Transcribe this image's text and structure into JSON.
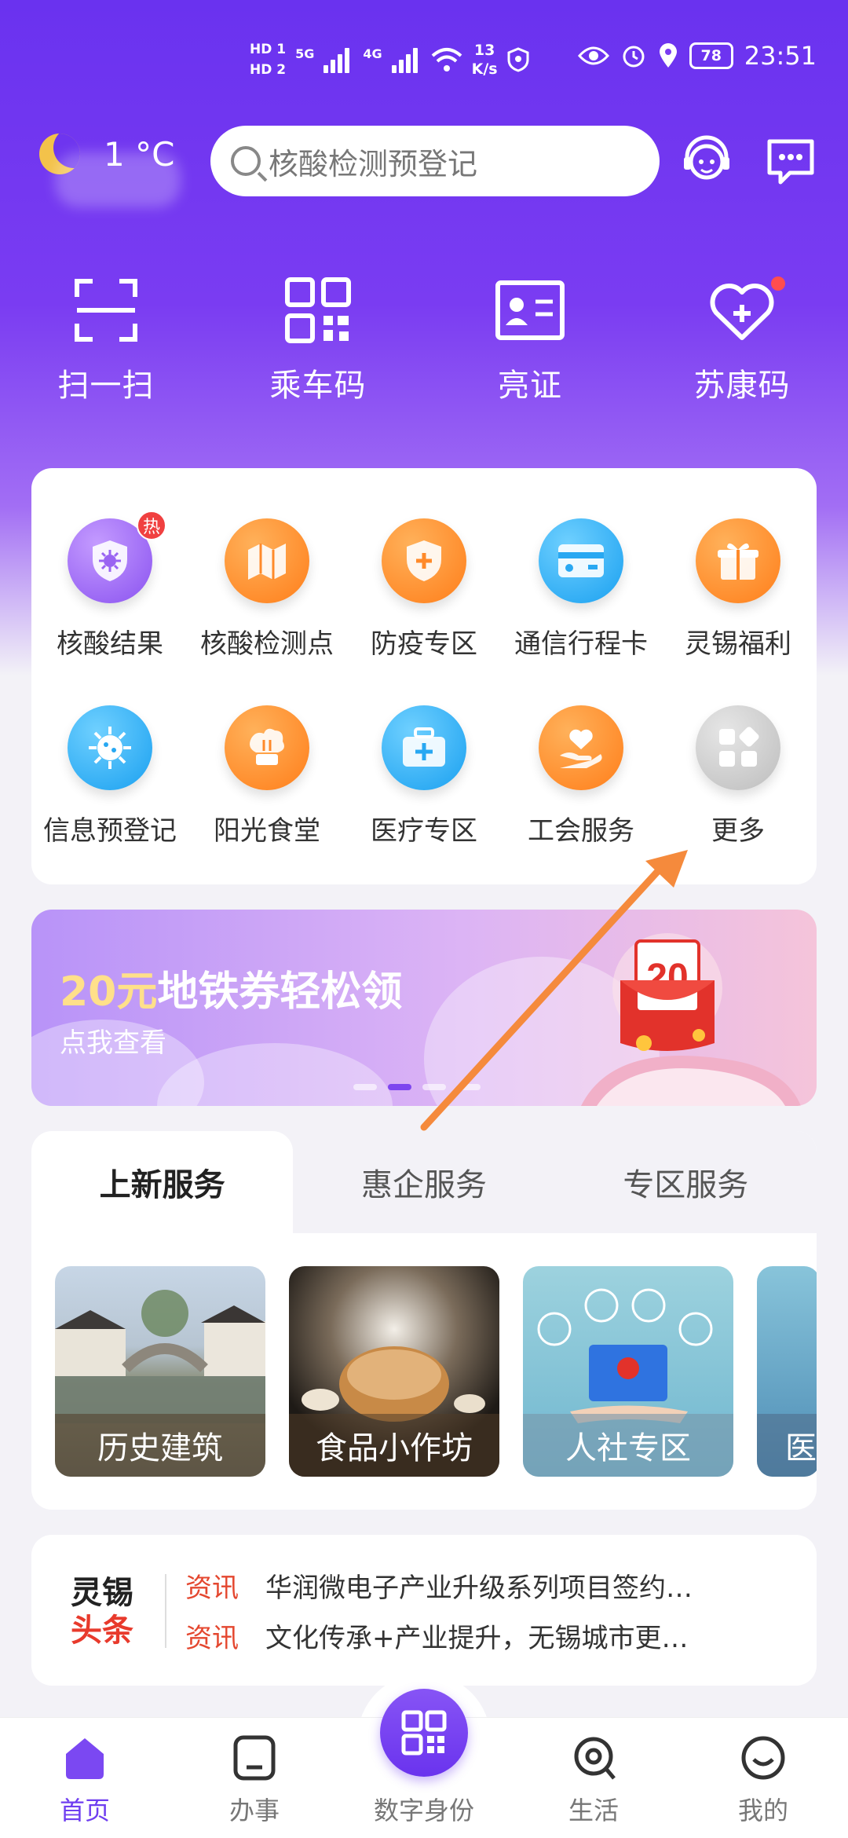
{
  "status_bar": {
    "hd1": "HD 1",
    "hd2": "HD 2",
    "net1": "5G",
    "net2": "4G",
    "speed_value": "13",
    "speed_unit": "K/s",
    "battery": "78",
    "time": "23:51"
  },
  "header": {
    "temperature": "1 °C",
    "search_placeholder": "核酸检测预登记"
  },
  "quick_actions": [
    {
      "label": "扫一扫",
      "icon": "scan-icon"
    },
    {
      "label": "乘车码",
      "icon": "qr-code-icon"
    },
    {
      "label": "亮证",
      "icon": "id-card-icon"
    },
    {
      "label": "苏康码",
      "icon": "health-heart-icon"
    }
  ],
  "services": {
    "row1": [
      {
        "label": "核酸结果",
        "icon": "virus-shield-icon",
        "badge": "热"
      },
      {
        "label": "核酸检测点",
        "icon": "map-icon"
      },
      {
        "label": "防疫专区",
        "icon": "shield-plus-icon"
      },
      {
        "label": "通信行程卡",
        "icon": "card-icon"
      },
      {
        "label": "灵锡福利",
        "icon": "gift-icon"
      }
    ],
    "row2": [
      {
        "label": "信息预登记",
        "icon": "virus-icon"
      },
      {
        "label": "阳光食堂",
        "icon": "chef-hat-icon"
      },
      {
        "label": "医疗专区",
        "icon": "medical-kit-icon"
      },
      {
        "label": "工会服务",
        "icon": "heart-hand-icon"
      },
      {
        "label": "更多",
        "icon": "more-grid-icon"
      }
    ]
  },
  "banner": {
    "title_highlight": "20元",
    "title_rest": "地铁券轻松领",
    "subtitle": "点我查看",
    "coupon_text": "20"
  },
  "tabs": {
    "items": [
      "上新服务",
      "惠企服务",
      "专区服务"
    ],
    "tiles": [
      "历史建筑",
      "食品小作坊",
      "人社专区",
      "医"
    ]
  },
  "news": {
    "logo_line1": "灵锡",
    "logo_line2": "头条",
    "items": [
      {
        "tag": "资讯",
        "text": "华润微电子产业升级系列项目签约…"
      },
      {
        "tag": "资讯",
        "text": "文化传承+产业提升，无锡城市更…"
      }
    ]
  },
  "bottom_nav": [
    "首页",
    "办事",
    "数字身份",
    "生活",
    "我的"
  ],
  "colors": {
    "brand": "#6a32ef",
    "accent_orange": "#ff7e1a",
    "accent_blue": "#1aa0f0",
    "news_red": "#e4472f"
  }
}
